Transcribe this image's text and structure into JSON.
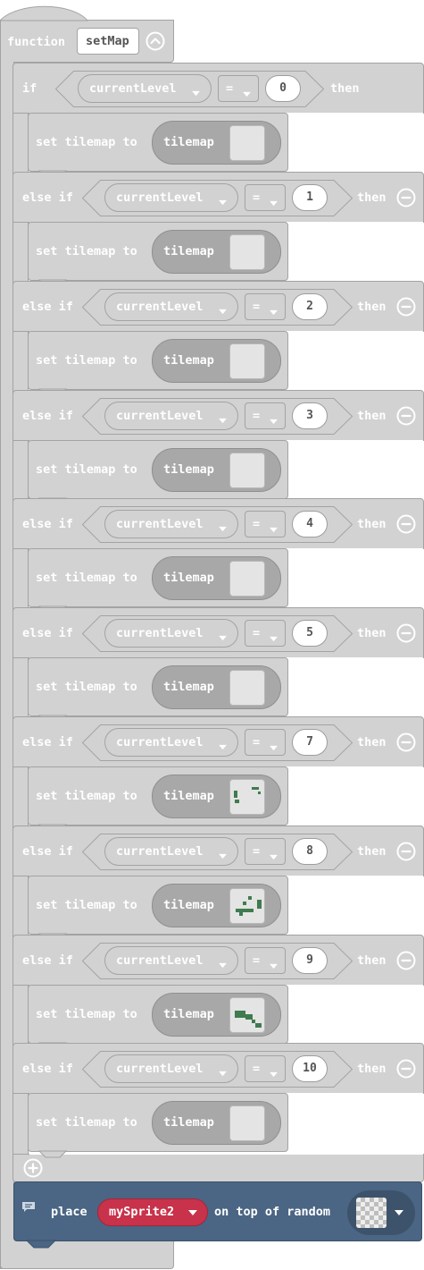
{
  "function": {
    "keyword": "function",
    "name": "setMap"
  },
  "branches": [
    {
      "keyword": "if",
      "variable": "currentLevel",
      "op": "=",
      "value": "0",
      "then": "then",
      "action": "set tilemap to",
      "tile_label": "tilemap",
      "removable": false
    },
    {
      "keyword": "else if",
      "variable": "currentLevel",
      "op": "=",
      "value": "1",
      "then": "then",
      "action": "set tilemap to",
      "tile_label": "tilemap",
      "removable": true
    },
    {
      "keyword": "else if",
      "variable": "currentLevel",
      "op": "=",
      "value": "2",
      "then": "then",
      "action": "set tilemap to",
      "tile_label": "tilemap",
      "removable": true
    },
    {
      "keyword": "else if",
      "variable": "currentLevel",
      "op": "=",
      "value": "3",
      "then": "then",
      "action": "set tilemap to",
      "tile_label": "tilemap",
      "removable": true
    },
    {
      "keyword": "else if",
      "variable": "currentLevel",
      "op": "=",
      "value": "4",
      "then": "then",
      "action": "set tilemap to",
      "tile_label": "tilemap",
      "removable": true
    },
    {
      "keyword": "else if",
      "variable": "currentLevel",
      "op": "=",
      "value": "5",
      "then": "then",
      "action": "set tilemap to",
      "tile_label": "tilemap",
      "removable": true
    },
    {
      "keyword": "else if",
      "variable": "currentLevel",
      "op": "=",
      "value": "7",
      "then": "then",
      "action": "set tilemap to",
      "tile_label": "tilemap",
      "removable": true
    },
    {
      "keyword": "else if",
      "variable": "currentLevel",
      "op": "=",
      "value": "8",
      "then": "then",
      "action": "set tilemap to",
      "tile_label": "tilemap",
      "removable": true
    },
    {
      "keyword": "else if",
      "variable": "currentLevel",
      "op": "=",
      "value": "9",
      "then": "then",
      "action": "set tilemap to",
      "tile_label": "tilemap",
      "removable": true
    },
    {
      "keyword": "else if",
      "variable": "currentLevel",
      "op": "=",
      "value": "10",
      "then": "then",
      "action": "set tilemap to",
      "tile_label": "tilemap",
      "removable": true
    }
  ],
  "place": {
    "label": "place",
    "sprite": "mySprite2",
    "suffix": "on top of random"
  },
  "colors": {
    "disabled_block": "#d2d2d2",
    "block_border": "#a3a3a3",
    "place_block": "#4b6584",
    "sprite_pill": "#c8324a",
    "tile_green": "#3f7b4f"
  },
  "icons": {
    "collapse": "chevron-up-icon",
    "remove": "minus-circle-icon",
    "add": "plus-circle-icon",
    "comment": "comment-icon",
    "dropdown": "caret-down-icon"
  }
}
